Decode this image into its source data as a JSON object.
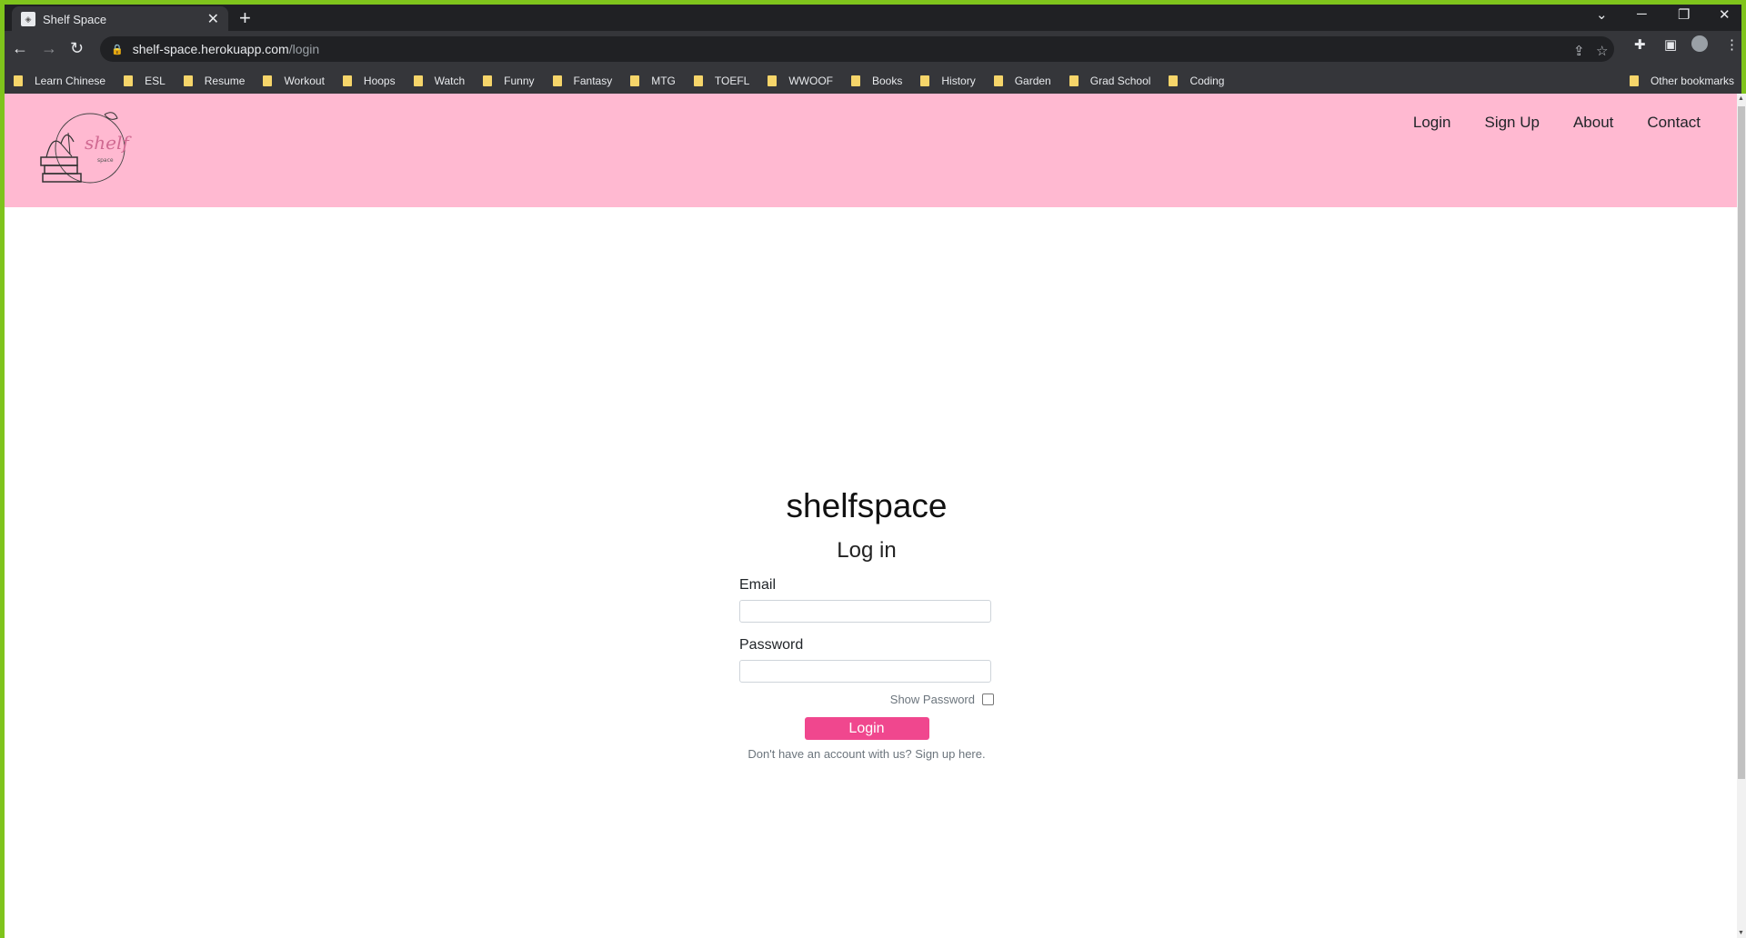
{
  "browser": {
    "tab_title": "Shelf Space",
    "url_domain": "shelf-space.herokuapp.com",
    "url_path": "/login",
    "bookmarks": [
      "Learn Chinese",
      "ESL",
      "Resume",
      "Workout",
      "Hoops",
      "Watch",
      "Funny",
      "Fantasy",
      "MTG",
      "TOEFL",
      "WWOOF",
      "Books",
      "History",
      "Garden",
      "Grad School",
      "Coding"
    ],
    "other_bookmarks": "Other bookmarks"
  },
  "site": {
    "logo_text": "shelf",
    "logo_sub": "space",
    "nav": [
      "Login",
      "Sign Up",
      "About",
      "Contact"
    ],
    "header_color": "#ffb9d1"
  },
  "login": {
    "brand": "shelfspace",
    "title": "Log in",
    "email_label": "Email",
    "password_label": "Password",
    "show_password": "Show Password",
    "button": "Login",
    "signup_text": "Don't have an account with us? Sign up here.",
    "accent": "#f0478e"
  }
}
